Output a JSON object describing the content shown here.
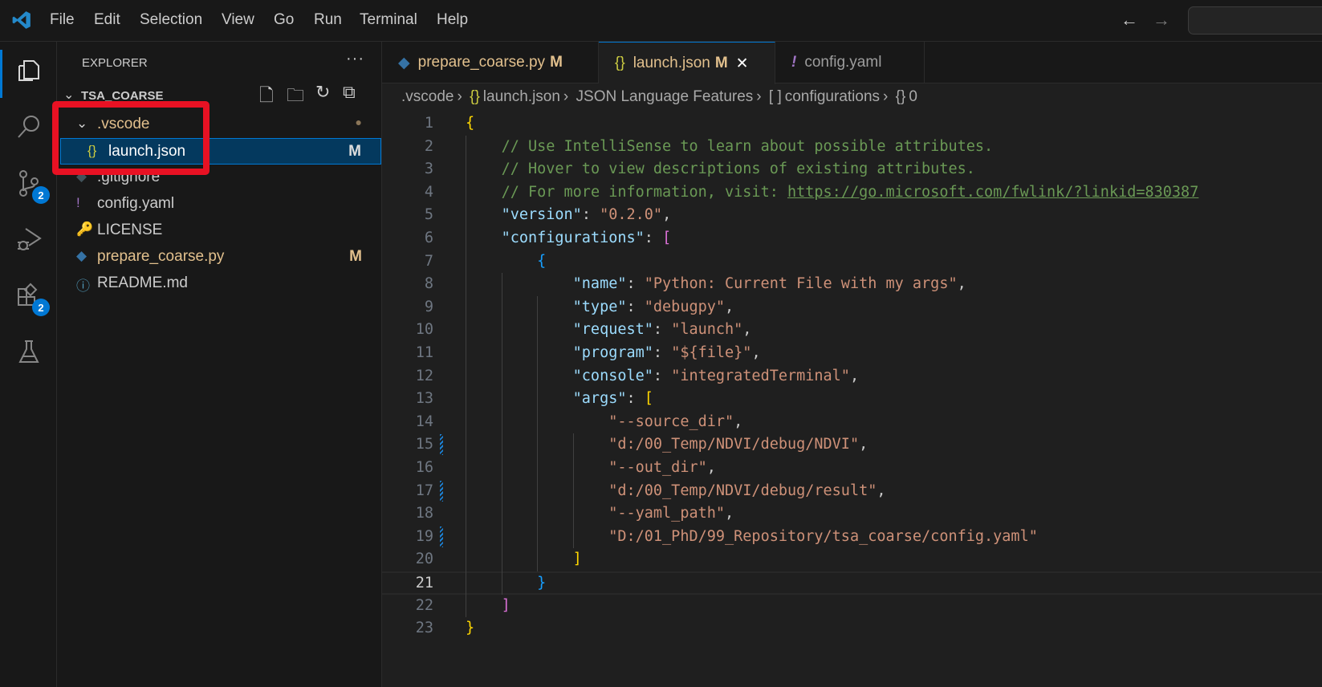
{
  "menu": [
    "File",
    "Edit",
    "Selection",
    "View",
    "Go",
    "Run",
    "Terminal",
    "Help"
  ],
  "activity": {
    "scm_badge": "2",
    "extensions_badge": "2"
  },
  "explorer": {
    "title": "EXPLORER",
    "more": "···",
    "root": "TSA_COARSE",
    "items": [
      {
        "name": ".vscode",
        "icon": "chevron-down-icon",
        "status": "●",
        "depth": 0
      },
      {
        "name": "launch.json",
        "icon": "json-icon",
        "status": "M",
        "depth": 1,
        "selected": true
      },
      {
        "name": ".gitignore",
        "icon": "git-icon",
        "status": "",
        "depth": 0
      },
      {
        "name": "config.yaml",
        "icon": "yaml-icon",
        "status": "",
        "depth": 0
      },
      {
        "name": "LICENSE",
        "icon": "license-icon",
        "status": "",
        "depth": 0
      },
      {
        "name": "prepare_coarse.py",
        "icon": "python-icon",
        "status": "M",
        "depth": 0
      },
      {
        "name": "README.md",
        "icon": "info-icon",
        "status": "",
        "depth": 0
      }
    ]
  },
  "tabs": [
    {
      "label": "prepare_coarse.py",
      "status": "M"
    },
    {
      "label": "launch.json",
      "status": "M",
      "close": "✕"
    },
    {
      "label": "config.yaml",
      "status": ""
    }
  ],
  "breadcrumb": [
    ".vscode",
    "launch.json",
    "JSON Language Features",
    "configurations",
    "0"
  ],
  "colors": {
    "accent": "#0078d4",
    "highlight": "#e81123"
  },
  "code": [
    [
      [
        "{",
        "b1"
      ]
    ],
    [
      [
        "    ",
        ""
      ],
      [
        "// Use IntelliSense to learn about possible attributes.",
        "c"
      ]
    ],
    [
      [
        "    ",
        ""
      ],
      [
        "// Hover to view descriptions of existing attributes.",
        "c"
      ]
    ],
    [
      [
        "    ",
        ""
      ],
      [
        "// For more information, visit: ",
        "c"
      ],
      [
        "https://go.microsoft.com/fwlink/?linkid=830387",
        "u"
      ]
    ],
    [
      [
        "    ",
        ""
      ],
      [
        "\"version\"",
        "k"
      ],
      [
        ": ",
        "p"
      ],
      [
        "\"0.2.0\"",
        "s"
      ],
      [
        ",",
        "p"
      ]
    ],
    [
      [
        "    ",
        ""
      ],
      [
        "\"configurations\"",
        "k"
      ],
      [
        ": ",
        "p"
      ],
      [
        "[",
        "b2"
      ]
    ],
    [
      [
        "        ",
        ""
      ],
      [
        "{",
        "b3"
      ]
    ],
    [
      [
        "            ",
        ""
      ],
      [
        "\"name\"",
        "k"
      ],
      [
        ": ",
        "p"
      ],
      [
        "\"Python: Current File with my args\"",
        "s"
      ],
      [
        ",",
        "p"
      ]
    ],
    [
      [
        "            ",
        ""
      ],
      [
        "\"type\"",
        "k"
      ],
      [
        ": ",
        "p"
      ],
      [
        "\"debugpy\"",
        "s"
      ],
      [
        ",",
        "p"
      ]
    ],
    [
      [
        "            ",
        ""
      ],
      [
        "\"request\"",
        "k"
      ],
      [
        ": ",
        "p"
      ],
      [
        "\"launch\"",
        "s"
      ],
      [
        ",",
        "p"
      ]
    ],
    [
      [
        "            ",
        ""
      ],
      [
        "\"program\"",
        "k"
      ],
      [
        ": ",
        "p"
      ],
      [
        "\"${file}\"",
        "s"
      ],
      [
        ",",
        "p"
      ]
    ],
    [
      [
        "            ",
        ""
      ],
      [
        "\"console\"",
        "k"
      ],
      [
        ": ",
        "p"
      ],
      [
        "\"integratedTerminal\"",
        "s"
      ],
      [
        ",",
        "p"
      ]
    ],
    [
      [
        "            ",
        ""
      ],
      [
        "\"args\"",
        "k"
      ],
      [
        ": ",
        "p"
      ],
      [
        "[",
        "b1"
      ]
    ],
    [
      [
        "                ",
        ""
      ],
      [
        "\"--source_dir\"",
        "s"
      ],
      [
        ",",
        "p"
      ]
    ],
    [
      [
        "                ",
        ""
      ],
      [
        "\"d:/00_Temp/NDVI/debug/NDVI\"",
        "s"
      ],
      [
        ",",
        "p"
      ]
    ],
    [
      [
        "                ",
        ""
      ],
      [
        "\"--out_dir\"",
        "s"
      ],
      [
        ",",
        "p"
      ]
    ],
    [
      [
        "                ",
        ""
      ],
      [
        "\"d:/00_Temp/NDVI/debug/result\"",
        "s"
      ],
      [
        ",",
        "p"
      ]
    ],
    [
      [
        "                ",
        ""
      ],
      [
        "\"--yaml_path\"",
        "s"
      ],
      [
        ",",
        "p"
      ]
    ],
    [
      [
        "                ",
        ""
      ],
      [
        "\"D:/01_PhD/99_Repository/tsa_coarse/config.yaml\"",
        "s"
      ]
    ],
    [
      [
        "            ",
        ""
      ],
      [
        "]",
        "b1"
      ]
    ],
    [
      [
        "        ",
        ""
      ],
      [
        "}",
        "b3"
      ]
    ],
    [
      [
        "    ",
        ""
      ],
      [
        "]",
        "b2"
      ]
    ],
    [
      [
        "}",
        "b1"
      ]
    ]
  ],
  "editor": {
    "current_line": 21,
    "modified_lines": [
      15,
      17,
      19
    ]
  }
}
